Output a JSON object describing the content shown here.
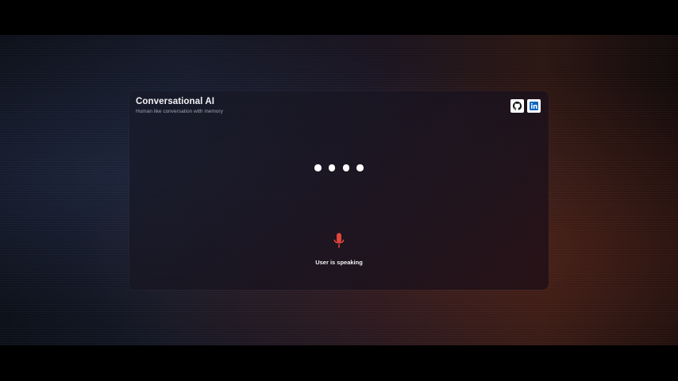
{
  "app": {
    "title": "Conversational AI",
    "subtitle": "Human like conversation with memory"
  },
  "links": [
    {
      "name": "GitHub",
      "icon": "github-icon"
    },
    {
      "name": "LinkedIn",
      "icon": "linkedin-icon"
    }
  ],
  "indicator": {
    "dot_count": 4,
    "mic_icon": "microphone-icon",
    "status_text": "User is speaking"
  },
  "colors": {
    "mic": "#e0453a",
    "linkedin": "#0a66c2",
    "text": "#f2f2f4",
    "subtext": "#9ea2ae"
  }
}
